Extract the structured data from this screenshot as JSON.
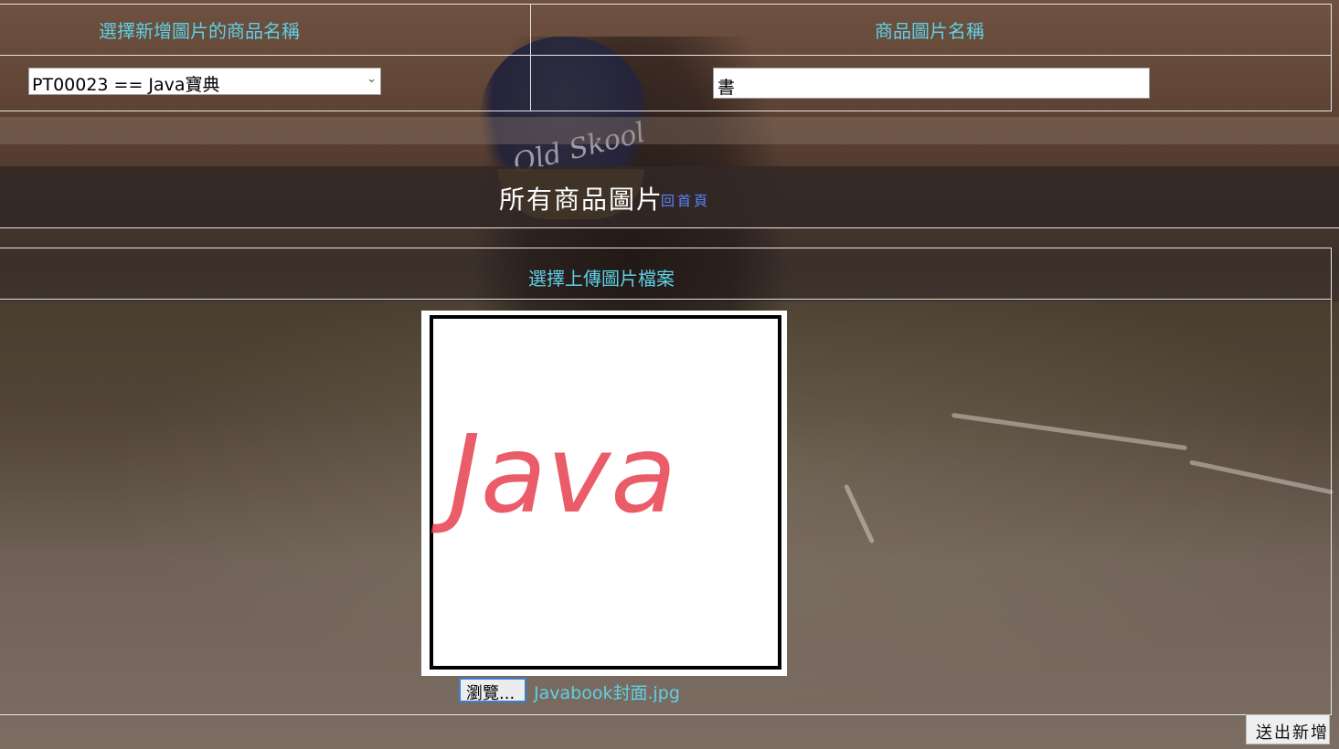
{
  "product_table": {
    "select_header": "選擇新增圖片的商品名稱",
    "name_header": "商品圖片名稱",
    "selected_product": "PT00023 == Java寶典",
    "image_name_value": "書"
  },
  "banner": {
    "title": "所有商品圖片",
    "back_link": "回首頁"
  },
  "upload": {
    "header": "選擇上傳圖片檔案",
    "browse_label": "瀏覽...",
    "file_name": "Javabook封面.jpg",
    "preview_text": "Java"
  },
  "actions": {
    "submit_label": "送出新增"
  },
  "background": {
    "cap_text": "Old Skool"
  },
  "colors": {
    "header_text": "#5fd0e5",
    "link": "#5a86ff",
    "preview_text": "#e8404f"
  }
}
